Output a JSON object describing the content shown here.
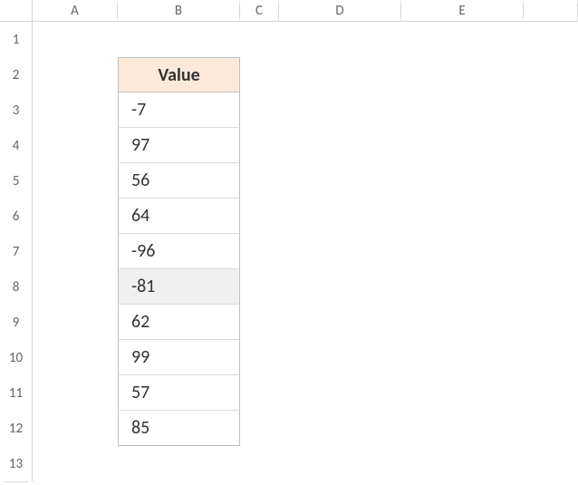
{
  "columns": [
    "A",
    "B",
    "C",
    "D",
    "E"
  ],
  "rows": [
    "1",
    "2",
    "3",
    "4",
    "5",
    "6",
    "7",
    "8",
    "9",
    "10",
    "11",
    "12",
    "13"
  ],
  "table": {
    "header": "Value",
    "values": [
      "-7",
      "97",
      "56",
      "64",
      "-96",
      "-81",
      "62",
      "99",
      "57",
      "85"
    ]
  },
  "hover_row_index": 5
}
